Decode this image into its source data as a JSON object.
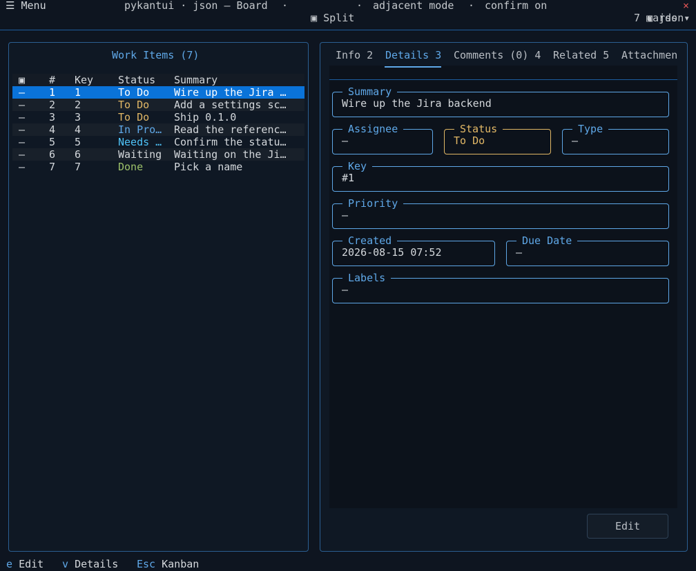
{
  "header": {
    "menu_icon": "menu-icon",
    "menu_label": "☰ Menu",
    "title": "pykantui · json — Board",
    "sep1": "·",
    "split_icon": "▣",
    "split_label": "Split",
    "sep2": "·",
    "mode_label": "adjacent mode",
    "sep3": "·",
    "confirm_label": "confirm on",
    "source_icon": "▣",
    "source_label": "json",
    "close_glyph": "×",
    "cards_label": "7 cards ▾"
  },
  "work_items": {
    "title": "Work Items (7)",
    "columns": [
      "▣",
      "#",
      "Key",
      "Status",
      "Summary"
    ],
    "rows": [
      {
        "sel": "—",
        "num": "1",
        "key": "1",
        "status": "To Do",
        "status_color": "#e2b866",
        "summary": "Wire up the Jira …"
      },
      {
        "sel": "—",
        "num": "2",
        "key": "2",
        "status": "To Do",
        "status_color": "#e2b866",
        "summary": "Add a settings sc…"
      },
      {
        "sel": "—",
        "num": "3",
        "key": "3",
        "status": "To Do",
        "status_color": "#e2b866",
        "summary": "Ship 0.1.0"
      },
      {
        "sel": "—",
        "num": "4",
        "key": "4",
        "status": "In Pro…",
        "status_color": "#5fa8e8",
        "summary": "Read the referenc…"
      },
      {
        "sel": "—",
        "num": "5",
        "key": "5",
        "status": "Needs …",
        "status_color": "#4fc3f7",
        "summary": "Confirm the statu…"
      },
      {
        "sel": "—",
        "num": "6",
        "key": "6",
        "status": "Waiting",
        "status_color": "#d4d8dc",
        "summary": "Waiting on the Ji…"
      },
      {
        "sel": "—",
        "num": "7",
        "key": "7",
        "status": "Done",
        "status_color": "#9dc26a",
        "summary": "Pick a name"
      }
    ],
    "selected_row": 0
  },
  "detail": {
    "tabs": [
      "Info 2",
      "Details 3",
      "Comments (0) 4",
      "Related 5",
      "Attachmen"
    ],
    "active_tab": 1,
    "fields": {
      "summary": {
        "label": "Summary",
        "value": "Wire up the Jira backend"
      },
      "assignee": {
        "label": "Assignee",
        "value": "—"
      },
      "status": {
        "label": "Status",
        "value": "To Do"
      },
      "type": {
        "label": "Type",
        "value": "—"
      },
      "key": {
        "label": "Key",
        "value": "#1"
      },
      "priority": {
        "label": "Priority",
        "value": "—"
      },
      "created": {
        "label": "Created",
        "value": "2026-08-15 07:52"
      },
      "due_date": {
        "label": "Due Date",
        "value": "—"
      },
      "labels": {
        "label": "Labels",
        "value": "—"
      }
    },
    "edit_label": "Edit"
  },
  "footer": {
    "bindings": [
      {
        "key": "e",
        "label": "Edit"
      },
      {
        "key": "v",
        "label": "Details"
      },
      {
        "key": "Esc",
        "label": "Kanban"
      }
    ]
  },
  "colors": {
    "accent": "#5fa8e8",
    "highlight": "#e2b866",
    "selection": "#0a73d9",
    "done": "#9dc26a",
    "close": "#e05555"
  }
}
